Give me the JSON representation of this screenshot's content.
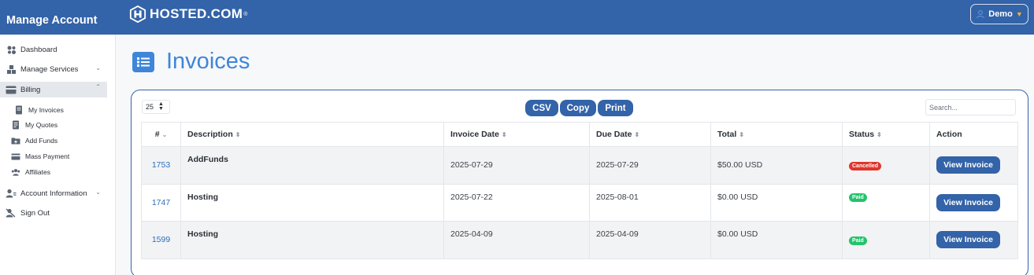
{
  "header": {
    "brand_title": "Manage Account",
    "logo_text": "HOSTED.COM",
    "logo_reg": "®",
    "user_label": "Demo"
  },
  "sidebar": {
    "items": [
      {
        "label": "Dashboard",
        "icon": "dashboard-icon"
      },
      {
        "label": "Manage Services",
        "icon": "services-icon",
        "chevron": "down"
      },
      {
        "label": "Billing",
        "icon": "billing-icon",
        "chevron": "up",
        "active": true
      },
      {
        "label": "Account Information",
        "icon": "account-icon",
        "chevron": "down"
      },
      {
        "label": "Sign Out",
        "icon": "sign-out-icon"
      }
    ],
    "billing_sub": [
      {
        "label": "My Invoices",
        "icon": "invoice-icon"
      },
      {
        "label": "My Quotes",
        "icon": "quotes-icon"
      },
      {
        "label": "Add Funds",
        "icon": "add-funds-icon"
      },
      {
        "label": "Mass Payment",
        "icon": "mass-payment-icon"
      },
      {
        "label": "Affiliates",
        "icon": "affiliates-icon"
      }
    ]
  },
  "page": {
    "title": "Invoices"
  },
  "table_controls": {
    "page_length": "25",
    "buttons": [
      "CSV",
      "Copy",
      "Print"
    ],
    "search_placeholder": "Search..."
  },
  "table": {
    "columns": [
      "#",
      "Description",
      "Invoice Date",
      "Due Date",
      "Total",
      "Status",
      "Action"
    ],
    "rows": [
      {
        "id": "1753",
        "description": "AddFunds",
        "invoice_date": "2025-07-29",
        "due_date": "2025-07-29",
        "total": "$50.00 USD",
        "status": "Cancelled",
        "action": "View Invoice"
      },
      {
        "id": "1747",
        "description": "Hosting",
        "invoice_date": "2025-07-22",
        "due_date": "2025-08-01",
        "total": "$0.00 USD",
        "status": "Paid",
        "action": "View Invoice"
      },
      {
        "id": "1599",
        "description": "Hosting",
        "invoice_date": "2025-04-09",
        "due_date": "2025-04-09",
        "total": "$0.00 USD",
        "status": "Paid",
        "action": "View Invoice"
      }
    ]
  },
  "colors": {
    "brand_blue": "#3363a8",
    "title_blue": "#3f86d8",
    "cancelled": "#e0352b",
    "paid": "#22c46b",
    "user_caret": "#f2b233"
  }
}
